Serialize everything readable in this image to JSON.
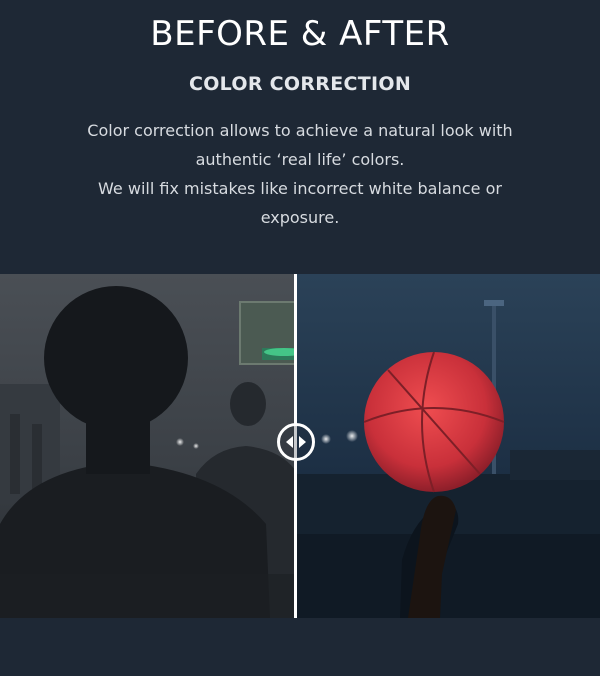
{
  "section": {
    "title": "BEFORE & AFTER",
    "subtitle": "COLOR CORRECTION",
    "description_lines": [
      "Color correction allows to achieve a natural look with",
      "authentic ‘real life’ colors.",
      "We will fix mistakes like incorrect white balance or",
      "exposure."
    ]
  },
  "comparison": {
    "before_label": "",
    "after_label": "",
    "split_percent": 49
  },
  "colors": {
    "background": "#1e2835",
    "divider": "#ffffff",
    "before_tint": "#2c3238",
    "after_tint": "#1b2a3d",
    "ball": "#d63a3e"
  },
  "icons": {
    "handle": "arrows-left-right-icon"
  }
}
